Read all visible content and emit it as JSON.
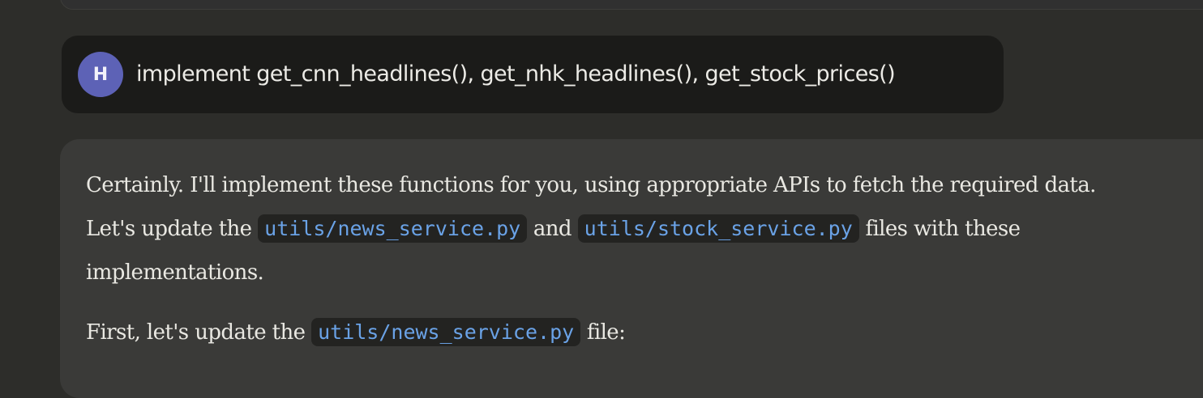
{
  "user_message": {
    "avatar_initial": "H",
    "text": "implement get_cnn_headlines(), get_nhk_headlines(), get_stock_prices()"
  },
  "assistant_message": {
    "paragraph1": {
      "text_before_code": "Certainly. I'll implement these functions for you, using appropriate APIs to fetch the required data. Let's update the ",
      "code1": "utils/news_service.py",
      "text_between": " and ",
      "code2": "utils/stock_service.py",
      "text_after": " files with these implementations."
    },
    "paragraph2": {
      "text_before_code": "First, let's update the ",
      "code": "utils/news_service.py",
      "text_after": " file:"
    }
  },
  "colors": {
    "page_background": "#2d2d2a",
    "user_bubble": "#1b1b19",
    "avatar": "#5d62b6",
    "assistant_bubble": "#3a3a38",
    "code_text": "#6aa2e6",
    "code_background": "#232321"
  }
}
